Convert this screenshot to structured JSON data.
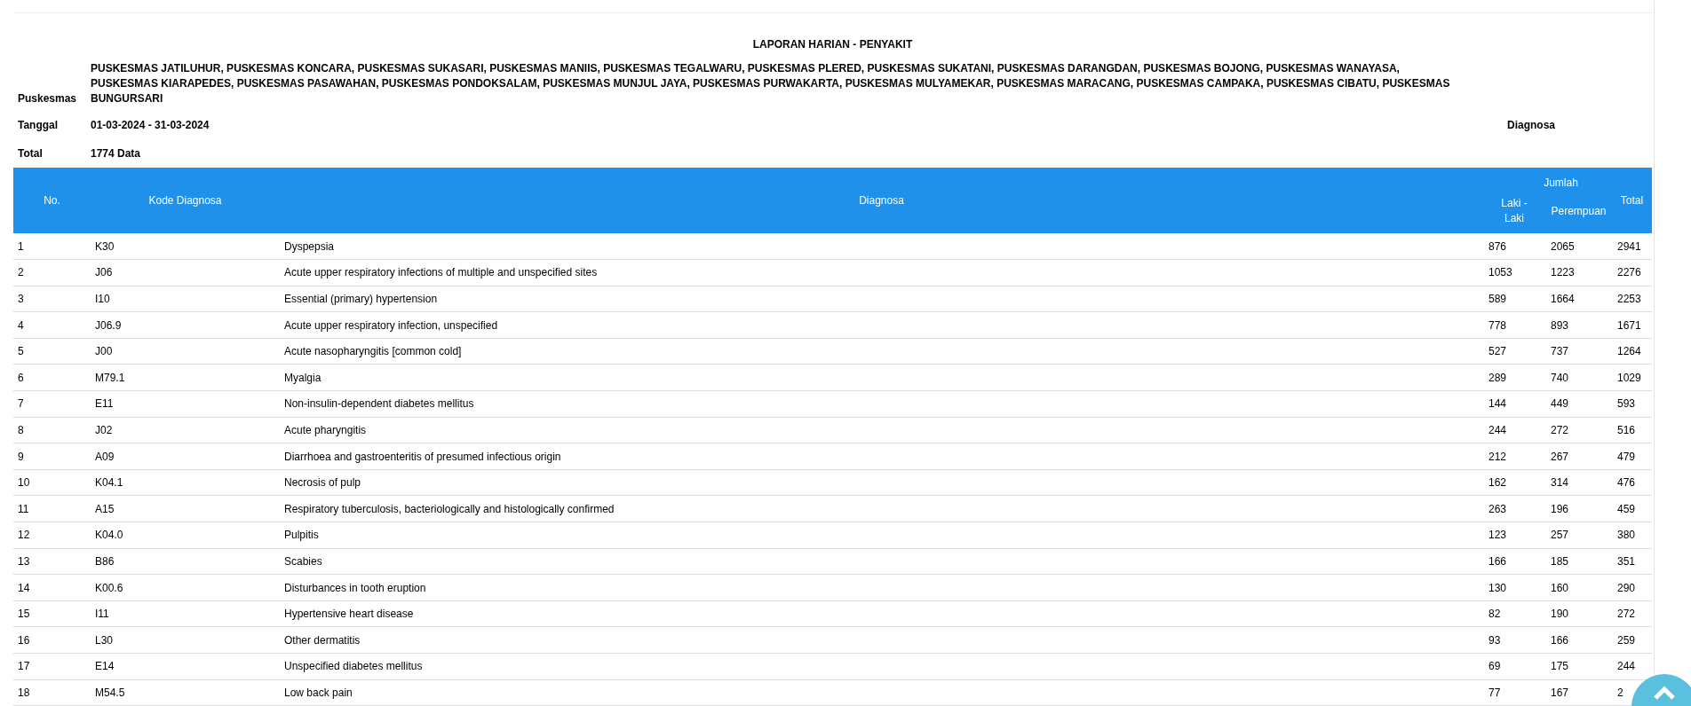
{
  "title": "LAPORAN HARIAN - PENYAKIT",
  "info": [
    {
      "label": "Puskesmas",
      "value": "PUSKESMAS JATILUHUR, PUSKESMAS KONCARA, PUSKESMAS SUKASARI, PUSKESMAS MANIIS, PUSKESMAS TEGALWARU, PUSKESMAS PLERED, PUSKESMAS SUKATANI, PUSKESMAS DARANGDAN, PUSKESMAS BOJONG, PUSKESMAS WANAYASA, PUSKESMAS KIARAPEDES, PUSKESMAS PASAWAHAN, PUSKESMAS PONDOKSALAM, PUSKESMAS MUNJUL JAYA, PUSKESMAS PURWAKARTA, PUSKESMAS MULYAMEKAR, PUSKESMAS MARACANG, PUSKESMAS CAMPAKA, PUSKESMAS CIBATU, PUSKESMAS BUNGURSARI"
    },
    {
      "label": "Tanggal",
      "value": "01-03-2024 - 31-03-2024",
      "side_label": "Diagnosa"
    },
    {
      "label": "Total",
      "value": "1774 Data"
    }
  ],
  "table": {
    "columns": {
      "no": "No.",
      "code": "Kode Diagnosa",
      "diagnosis": "Diagnosa",
      "group": "Jumlah",
      "male": "Laki - Laki",
      "female": "Perempuan",
      "total": "Total"
    },
    "rows": [
      [
        "1",
        "K30",
        "Dyspepsia",
        "876",
        "2065",
        "2941"
      ],
      [
        "2",
        "J06",
        "Acute upper respiratory infections of multiple and unspecified sites",
        "1053",
        "1223",
        "2276"
      ],
      [
        "3",
        "I10",
        "Essential (primary) hypertension",
        "589",
        "1664",
        "2253"
      ],
      [
        "4",
        "J06.9",
        "Acute upper respiratory infection, unspecified",
        "778",
        "893",
        "1671"
      ],
      [
        "5",
        "J00",
        "Acute nasopharyngitis [common cold]",
        "527",
        "737",
        "1264"
      ],
      [
        "6",
        "M79.1",
        "Myalgia",
        "289",
        "740",
        "1029"
      ],
      [
        "7",
        "E11",
        "Non-insulin-dependent diabetes mellitus",
        "144",
        "449",
        "593"
      ],
      [
        "8",
        "J02",
        "Acute pharyngitis",
        "244",
        "272",
        "516"
      ],
      [
        "9",
        "A09",
        "Diarrhoea and gastroenteritis of presumed infectious origin",
        "212",
        "267",
        "479"
      ],
      [
        "10",
        "K04.1",
        "Necrosis of pulp",
        "162",
        "314",
        "476"
      ],
      [
        "11",
        "A15",
        "Respiratory tuberculosis, bacteriologically and histologically confirmed",
        "263",
        "196",
        "459"
      ],
      [
        "12",
        "K04.0",
        "Pulpitis",
        "123",
        "257",
        "380"
      ],
      [
        "13",
        "B86",
        "Scabies",
        "166",
        "185",
        "351"
      ],
      [
        "14",
        "K00.6",
        "Disturbances in tooth eruption",
        "130",
        "160",
        "290"
      ],
      [
        "15",
        "I11",
        "Hypertensive heart disease",
        "82",
        "190",
        "272"
      ],
      [
        "16",
        "L30",
        "Other dermatitis",
        "93",
        "166",
        "259"
      ],
      [
        "17",
        "E14",
        "Unspecified diabetes mellitus",
        "69",
        "175",
        "244"
      ],
      [
        "18",
        "M54.5",
        "Low back pain",
        "77",
        "167",
        "2"
      ]
    ]
  }
}
